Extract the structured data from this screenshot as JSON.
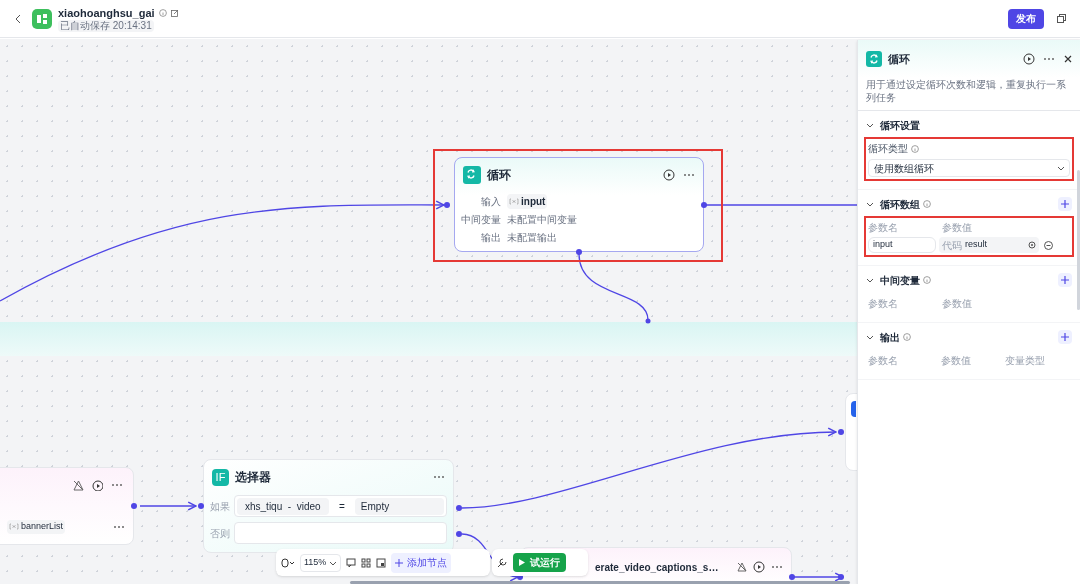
{
  "header": {
    "title": "xiaohoanghsu_gai",
    "save_status": "已自动保存 20:14:31",
    "publish_button": "发布"
  },
  "loop_node": {
    "title": "循环",
    "highlighted": true,
    "rows": [
      {
        "label": "输入",
        "value": "input",
        "kind": "variable"
      },
      {
        "label": "中间变量",
        "value": "未配置中间变量",
        "kind": "empty"
      },
      {
        "label": "输出",
        "value": "未配置输出",
        "kind": "empty"
      }
    ]
  },
  "left_node": {
    "variable": "bannerList"
  },
  "selector_node": {
    "badge": "IF",
    "title": "选择器",
    "if_label": "如果",
    "condition_left": "xhs_tiqu  -  video",
    "operator": "=",
    "condition_right": "Empty",
    "else_label": "否则"
  },
  "bottom_node": {
    "title": "erate_video_captions_s…"
  },
  "toolbar": {
    "zoom": "115%",
    "add_node": "添加节点",
    "run": "试运行"
  },
  "panel": {
    "title": "循环",
    "description": "用于通过设定循环次数和逻辑，重复执行一系列任务",
    "sections": [
      {
        "kind": "select",
        "title": "循环设置",
        "field_label": "循环类型",
        "value": "使用数组循环",
        "highlighted": true
      },
      {
        "kind": "params",
        "title": "循环数组",
        "columns": [
          "参数名",
          "参数值"
        ],
        "highlighted": true,
        "rows": [
          {
            "name": "input",
            "source": "代码",
            "value": "result"
          }
        ]
      },
      {
        "kind": "params",
        "title": "中间变量",
        "columns": [
          "参数名",
          "参数值"
        ],
        "highlighted": false
      },
      {
        "kind": "params",
        "title": "输出",
        "columns": [
          "参数名",
          "参数值",
          "变量类型"
        ],
        "highlighted": false
      }
    ]
  }
}
